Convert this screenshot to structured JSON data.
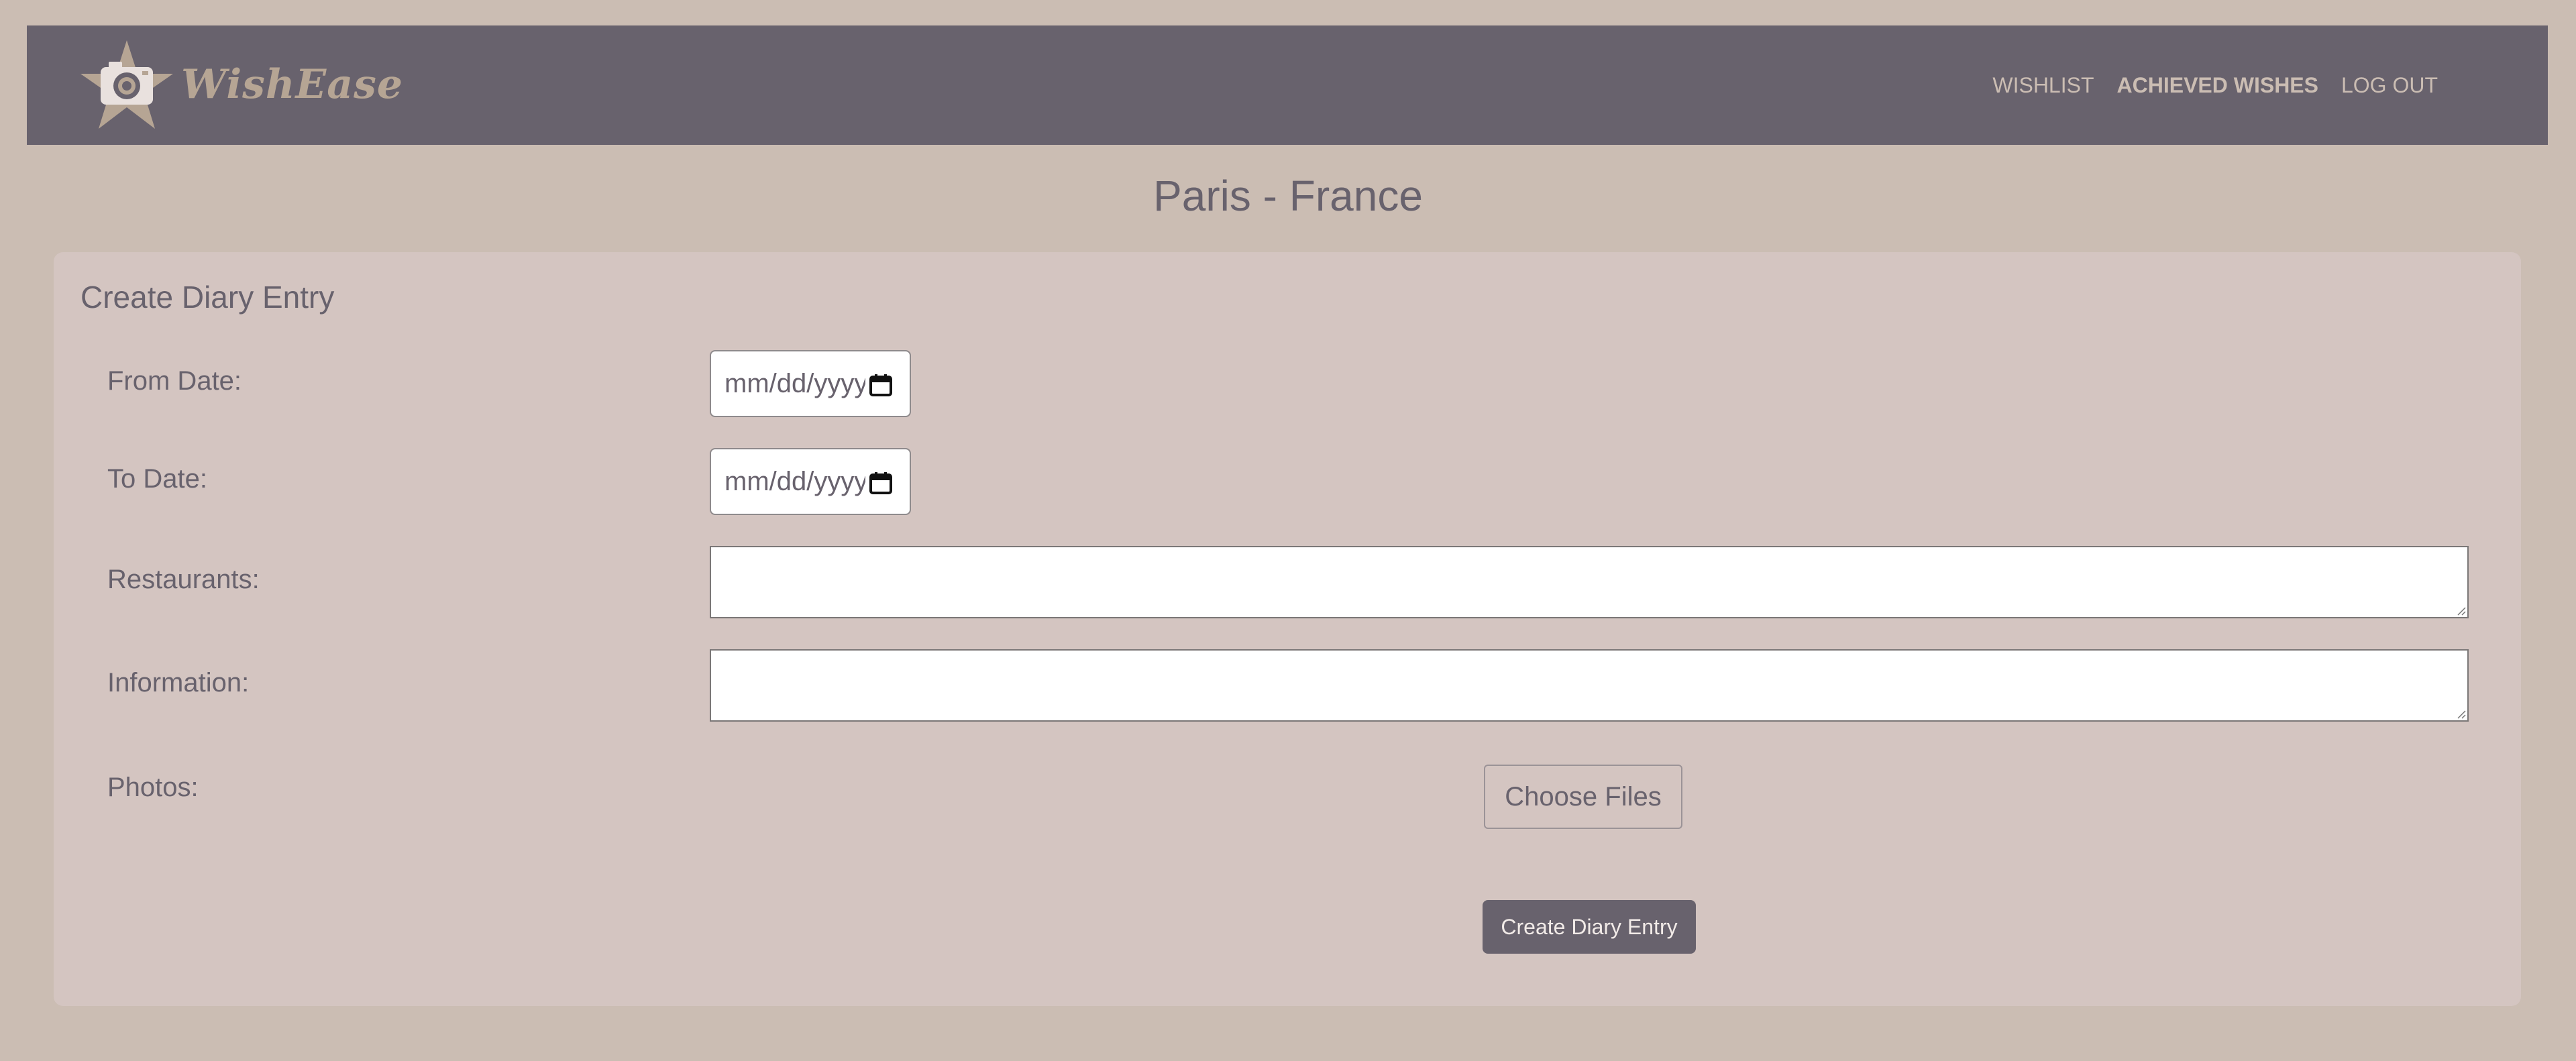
{
  "app": {
    "name": "WishEase",
    "colors": {
      "background": "#cbbdb3",
      "navbar": "#68626d",
      "card": "#d4c5c1",
      "accent": "#b6a594",
      "text": "#68626d"
    }
  },
  "nav": {
    "logo_icon": "camera-star-icon",
    "links": [
      {
        "label": "WISHLIST",
        "active": false
      },
      {
        "label": "ACHIEVED WISHES",
        "active": true
      },
      {
        "label": "LOG OUT",
        "active": false
      }
    ]
  },
  "page": {
    "title": "Paris - France"
  },
  "form": {
    "title": "Create Diary Entry",
    "from_date": {
      "label": "From Date:",
      "placeholder": "mm/dd/yyyy",
      "icon": "calendar-icon"
    },
    "to_date": {
      "label": "To Date:",
      "placeholder": "mm/dd/yyyy",
      "icon": "calendar-icon"
    },
    "restaurants": {
      "label": "Restaurants:",
      "value": ""
    },
    "information": {
      "label": "Information:",
      "value": ""
    },
    "photos": {
      "label": "Photos:",
      "button_label": "Choose Files"
    },
    "submit_label": "Create Diary Entry"
  }
}
